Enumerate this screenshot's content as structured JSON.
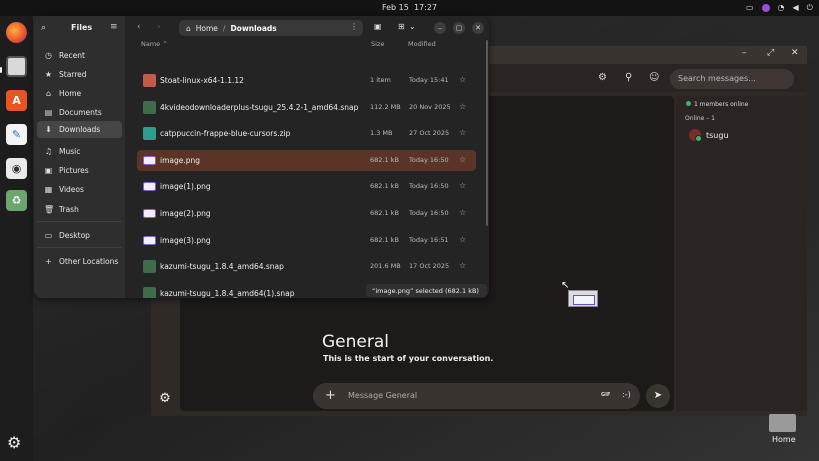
{
  "topbar": {
    "date": "Feb 15",
    "time": "17:27",
    "tray_icons": [
      "printer-icon",
      "record-icon",
      "network-icon",
      "volume-icon",
      "power-icon"
    ]
  },
  "dock": {
    "apps": [
      "firefox",
      "files",
      "app-center",
      "text-editor",
      "gimp",
      "trash"
    ]
  },
  "files": {
    "title": "Files",
    "path": {
      "root": "Home",
      "current": "Downloads"
    },
    "sidebar": [
      {
        "label": "Recent",
        "icon": "◷"
      },
      {
        "label": "Starred",
        "icon": "★"
      },
      {
        "label": "Home",
        "icon": "⌂"
      },
      {
        "label": "Documents",
        "icon": "▤"
      },
      {
        "label": "Downloads",
        "icon": "⬇"
      },
      {
        "label": "Music",
        "icon": "♫"
      },
      {
        "label": "Pictures",
        "icon": "▣"
      },
      {
        "label": "Videos",
        "icon": "▦"
      },
      {
        "label": "Trash",
        "icon": "🗑"
      },
      {
        "label": "Desktop",
        "icon": "▭"
      },
      {
        "label": "Other Locations",
        "icon": "+"
      }
    ],
    "columns": {
      "name": "Name",
      "size": "Size",
      "modified": "Modified"
    },
    "rows": [
      {
        "name": "Stoat-linux-x64-1.1.12",
        "size": "1 item",
        "date": "Today 15:41",
        "type": "folder"
      },
      {
        "name": "4kvideodownloaderplus-tsugu_25.4.2-1_amd64.snap",
        "size": "112.2 MB",
        "date": "20 Nov 2025",
        "type": "snap"
      },
      {
        "name": "catppuccin-frappe-blue-cursors.zip",
        "size": "1.3 MB",
        "date": "27 Oct 2025",
        "type": "zip"
      },
      {
        "name": "image.png",
        "size": "682.1 kB",
        "date": "Today 16:50",
        "type": "png"
      },
      {
        "name": "image(1).png",
        "size": "682.1 kB",
        "date": "Today 16:50",
        "type": "png"
      },
      {
        "name": "image(2).png",
        "size": "682.1 kB",
        "date": "Today 16:50",
        "type": "png"
      },
      {
        "name": "image(3).png",
        "size": "682.1 kB",
        "date": "Today 16:51",
        "type": "png"
      },
      {
        "name": "kazumi-tsugu_1.8.4_amd64.snap",
        "size": "201.6 MB",
        "date": "17 Oct 2025",
        "type": "snap"
      },
      {
        "name": "kazumi-tsugu_1.8.4_amd64(1).snap",
        "size": "",
        "date": "",
        "type": "snap"
      }
    ],
    "status": "“image.png” selected  (682.1 kB)"
  },
  "chat": {
    "search_placeholder": "Search messages...",
    "members_online": "1 members online",
    "online_heading": "Online – 1",
    "user": "tsugu",
    "channel_title": "General",
    "channel_sub": "This is the start of your conversation.",
    "message_placeholder": "Message General",
    "gif_label": "GIF",
    "emoji_label": ":-)"
  },
  "desktop": {
    "home_label": "Home"
  }
}
